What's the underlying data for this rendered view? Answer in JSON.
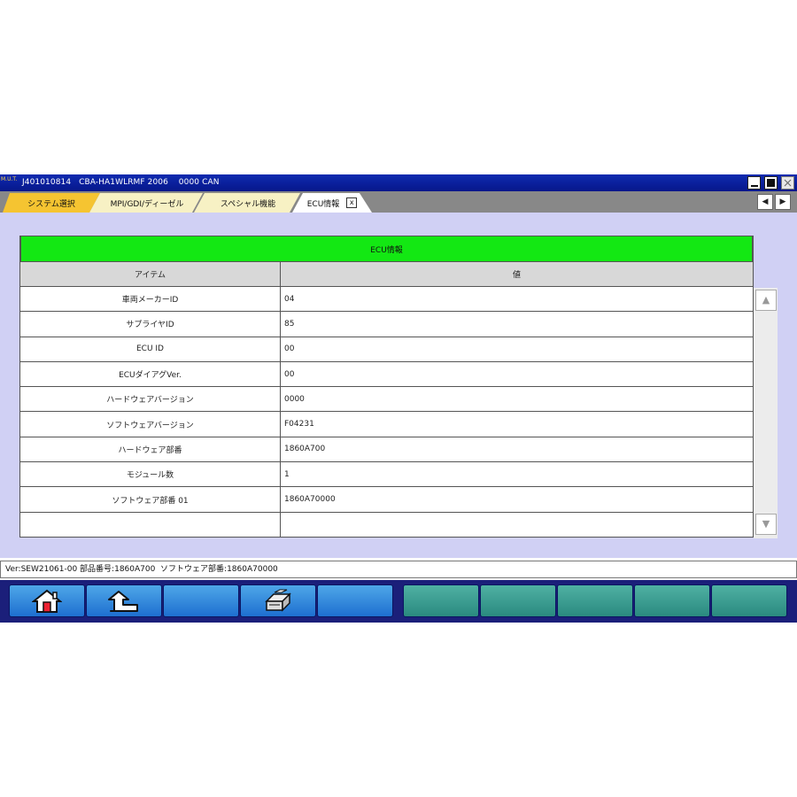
{
  "titlebar": {
    "logo_text": "M.U.T.",
    "title": "J401010814   CBA-HA1WLRMF 2006    0000 CAN"
  },
  "tabs": [
    {
      "label": "システム選択"
    },
    {
      "label": "MPI/GDI/ディーゼル"
    },
    {
      "label": "スペシャル機能"
    },
    {
      "label": "ECU情報",
      "close_glyph": "x"
    }
  ],
  "tab_scroll": {
    "left_glyph": "◀",
    "right_glyph": "▶"
  },
  "table": {
    "title": "ECU情報",
    "headers": [
      "アイテム",
      "値"
    ],
    "rows": [
      {
        "item": "車両メーカーID",
        "value": "04"
      },
      {
        "item": "サプライヤID",
        "value": "85"
      },
      {
        "item": "ECU ID",
        "value": "00"
      },
      {
        "item": "ECUダイアグVer.",
        "value": "00"
      },
      {
        "item": "ハードウェアバージョン",
        "value": "0000"
      },
      {
        "item": "ソフトウェアバージョン",
        "value": "F04231"
      },
      {
        "item": "ハードウェア部番",
        "value": "1860A700"
      },
      {
        "item": "モジュール数",
        "value": "1"
      },
      {
        "item": "ソフトウェア部番 01",
        "value": "1860A70000"
      },
      {
        "item": "",
        "value": ""
      }
    ]
  },
  "scrollbar": {
    "up_glyph": "▲",
    "down_glyph": "▼"
  },
  "statusbar": {
    "text": "Ver:SEW21061-00 部品番号:1860A700  ソフトウェア部番:1860A70000"
  },
  "toolbar": {
    "buttons": [
      {
        "icon": "home-icon"
      },
      {
        "icon": "back-icon"
      },
      {
        "icon": ""
      },
      {
        "icon": "print-icon"
      },
      {
        "icon": ""
      }
    ]
  },
  "colors": {
    "titlebar": "#0a1e9e",
    "table_title": "#13e813",
    "content_bg": "#d0d0f4",
    "toolbar_bg": "#1b1f7a"
  }
}
